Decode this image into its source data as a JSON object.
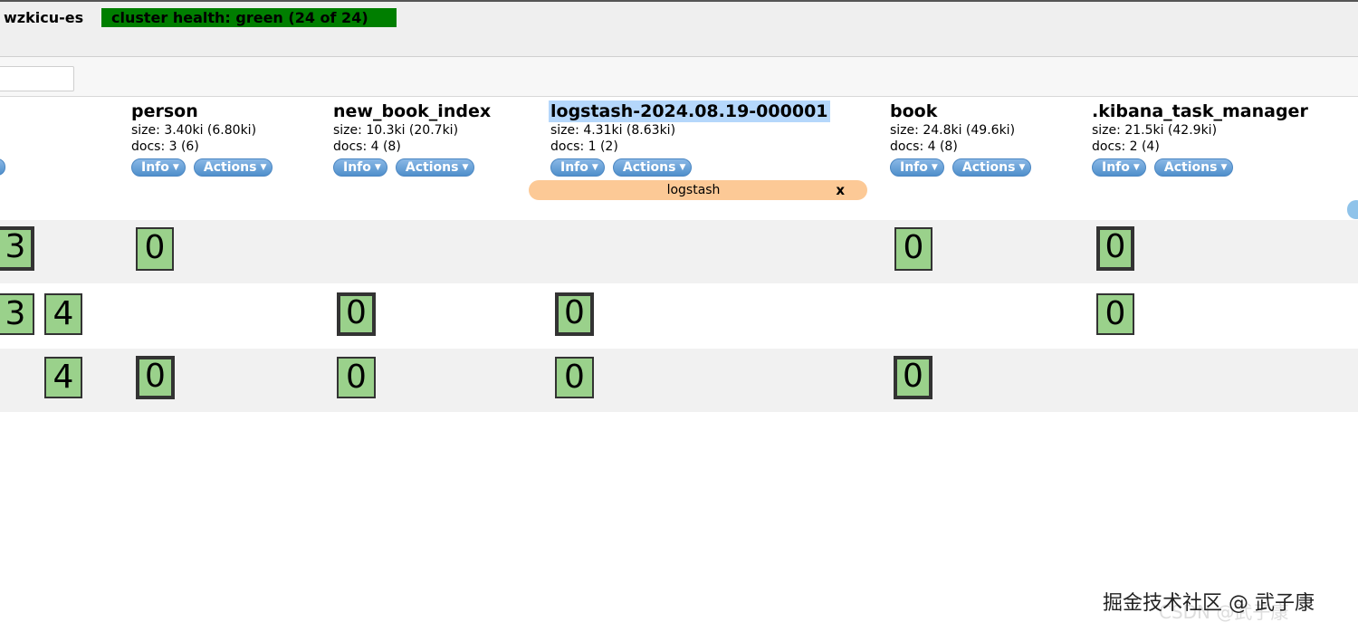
{
  "cluster": {
    "name": "wzkicu-es",
    "health": "cluster health: green (24 of 24)",
    "health_color": "#007e00"
  },
  "filter": {
    "placeholder": ""
  },
  "indices": [
    {
      "name": "person",
      "size": "size: 3.40ki (6.80ki)",
      "docs": "docs: 3 (6)",
      "info": "Info",
      "actions": "Actions"
    },
    {
      "name": "new_book_index",
      "size": "size: 10.3ki (20.7ki)",
      "docs": "docs: 4 (8)",
      "info": "Info",
      "actions": "Actions"
    },
    {
      "name": "logstash-2024.08.19-000001",
      "size": "size: 4.31ki (8.63ki)",
      "docs": "docs: 1 (2)",
      "info": "Info",
      "actions": "Actions",
      "alias": "logstash",
      "alias_close": "x"
    },
    {
      "name": "book",
      "size": "size: 24.8ki (49.6ki)",
      "docs": "docs: 4 (8)",
      "info": "Info",
      "actions": "Actions"
    },
    {
      "name": ".kibana_task_manager",
      "size": "size: 21.5ki (42.9ki)",
      "docs": "docs: 2 (4)",
      "info": "Info",
      "actions": "Actions"
    }
  ],
  "shards": {
    "row1": [
      "3",
      "0",
      "0",
      "0"
    ],
    "row2": [
      "3",
      "4",
      "0",
      "0",
      "0"
    ],
    "row3": [
      "4",
      "0",
      "0",
      "0",
      "0"
    ]
  },
  "watermark": "掘金技术社区 @ 武子康",
  "watermark_ghost": "CSDN @武子康",
  "colors": {
    "shard_fill": "#9ad18b",
    "alias_bg": "#fcc996",
    "button_blue": "#5a97d0",
    "selection": "#b5d7fb"
  }
}
